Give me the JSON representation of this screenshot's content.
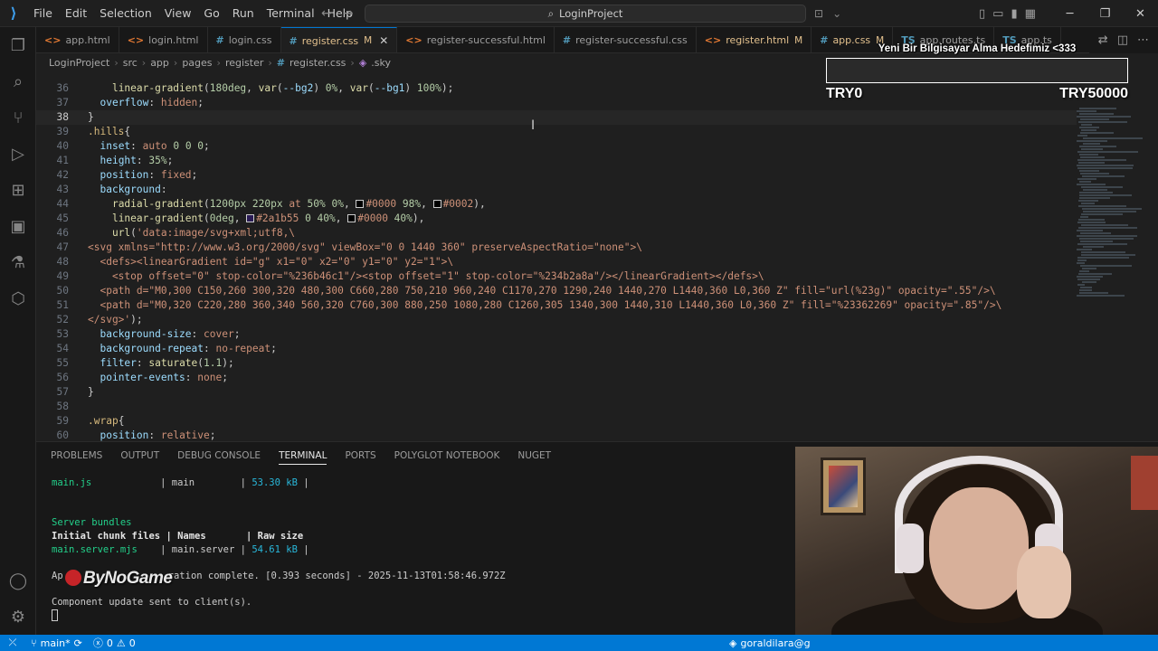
{
  "titlebar": {
    "menu": [
      "File",
      "Edit",
      "Selection",
      "View",
      "Go",
      "Run",
      "Terminal",
      "Help"
    ],
    "search_label": "LoginProject"
  },
  "tabs": [
    {
      "icon": "<>",
      "icon_color": "#e37933",
      "label": "app.html",
      "modified": "",
      "active": false
    },
    {
      "icon": "<>",
      "icon_color": "#e37933",
      "label": "login.html",
      "modified": "",
      "active": false
    },
    {
      "icon": "#",
      "icon_color": "#519aba",
      "label": "login.css",
      "modified": "",
      "active": false
    },
    {
      "icon": "#",
      "icon_color": "#519aba",
      "label": "register.css",
      "modified": "M",
      "active": true
    },
    {
      "icon": "<>",
      "icon_color": "#e37933",
      "label": "register-successful.html",
      "modified": "",
      "active": false
    },
    {
      "icon": "#",
      "icon_color": "#519aba",
      "label": "register-successful.css",
      "modified": "",
      "active": false
    },
    {
      "icon": "<>",
      "icon_color": "#e37933",
      "label": "register.html",
      "modified": "M",
      "active": false
    },
    {
      "icon": "#",
      "icon_color": "#519aba",
      "label": "app.css",
      "modified": "M",
      "active": false
    },
    {
      "icon": "TS",
      "icon_color": "#519aba",
      "label": "app.routes.ts",
      "modified": "",
      "active": false
    },
    {
      "icon": "TS",
      "icon_color": "#519aba",
      "label": "app.ts",
      "modified": "",
      "active": false
    }
  ],
  "breadcrumb": [
    "LoginProject",
    "src",
    "app",
    "pages",
    "register",
    "register.css",
    ".sky"
  ],
  "editor": {
    "lines": [
      {
        "n": "36",
        "tokens": [
          [
            "c-punc",
            "    "
          ],
          [
            "c-fn",
            "linear-gradient"
          ],
          [
            "c-punc",
            "("
          ],
          [
            "c-num",
            "180deg"
          ],
          [
            "c-punc",
            ", "
          ],
          [
            "c-fn",
            "var"
          ],
          [
            "c-punc",
            "("
          ],
          [
            "c-prop",
            "--bg2"
          ],
          [
            "c-punc",
            ") "
          ],
          [
            "c-num",
            "0%"
          ],
          [
            "c-punc",
            ", "
          ],
          [
            "c-fn",
            "var"
          ],
          [
            "c-punc",
            "("
          ],
          [
            "c-prop",
            "--bg1"
          ],
          [
            "c-punc",
            ") "
          ],
          [
            "c-num",
            "100%"
          ],
          [
            "c-punc",
            ");"
          ]
        ]
      },
      {
        "n": "37",
        "tokens": [
          [
            "c-punc",
            "  "
          ],
          [
            "c-prop",
            "overflow"
          ],
          [
            "c-punc",
            ": "
          ],
          [
            "c-val",
            "hidden"
          ],
          [
            "c-punc",
            ";"
          ]
        ]
      },
      {
        "n": "38",
        "cur": true,
        "tokens": [
          [
            "c-punc",
            "}"
          ]
        ]
      },
      {
        "n": "39",
        "tokens": [
          [
            "c-sel",
            ".hills"
          ],
          [
            "c-punc",
            "{"
          ]
        ]
      },
      {
        "n": "40",
        "tokens": [
          [
            "c-punc",
            "  "
          ],
          [
            "c-prop",
            "inset"
          ],
          [
            "c-punc",
            ": "
          ],
          [
            "c-val",
            "auto "
          ],
          [
            "c-num",
            "0 0 0"
          ],
          [
            "c-punc",
            ";"
          ]
        ]
      },
      {
        "n": "41",
        "tokens": [
          [
            "c-punc",
            "  "
          ],
          [
            "c-prop",
            "height"
          ],
          [
            "c-punc",
            ": "
          ],
          [
            "c-num",
            "35%"
          ],
          [
            "c-punc",
            ";"
          ]
        ]
      },
      {
        "n": "42",
        "tokens": [
          [
            "c-punc",
            "  "
          ],
          [
            "c-prop",
            "position"
          ],
          [
            "c-punc",
            ": "
          ],
          [
            "c-val",
            "fixed"
          ],
          [
            "c-punc",
            ";"
          ]
        ]
      },
      {
        "n": "43",
        "tokens": [
          [
            "c-punc",
            "  "
          ],
          [
            "c-prop",
            "background"
          ],
          [
            "c-punc",
            ":"
          ]
        ]
      },
      {
        "n": "44",
        "tokens": [
          [
            "c-punc",
            "    "
          ],
          [
            "c-fn",
            "radial-gradient"
          ],
          [
            "c-punc",
            "("
          ],
          [
            "c-num",
            "1200px 220px"
          ],
          [
            "c-val",
            " at "
          ],
          [
            "c-num",
            "50% 0%"
          ],
          [
            "c-punc",
            ", "
          ],
          [
            "swatch",
            "#000000"
          ],
          [
            "c-val",
            "#0000 "
          ],
          [
            "c-num",
            "98%"
          ],
          [
            "c-punc",
            ", "
          ],
          [
            "swatch",
            "#000000"
          ],
          [
            "c-val",
            "#0002"
          ],
          [
            "c-punc",
            "),"
          ]
        ]
      },
      {
        "n": "45",
        "tokens": [
          [
            "c-punc",
            "    "
          ],
          [
            "c-fn",
            "linear-gradient"
          ],
          [
            "c-punc",
            "("
          ],
          [
            "c-num",
            "0deg"
          ],
          [
            "c-punc",
            ", "
          ],
          [
            "swatch",
            "#2a1b55"
          ],
          [
            "c-val",
            "#2a1b55 "
          ],
          [
            "c-num",
            "0 40%"
          ],
          [
            "c-punc",
            ", "
          ],
          [
            "swatch",
            "#000000"
          ],
          [
            "c-val",
            "#0000 "
          ],
          [
            "c-num",
            "40%"
          ],
          [
            "c-punc",
            "),"
          ]
        ]
      },
      {
        "n": "46",
        "tokens": [
          [
            "c-punc",
            "    "
          ],
          [
            "c-fn",
            "url"
          ],
          [
            "c-punc",
            "("
          ],
          [
            "c-val",
            "'data:image/svg+xml;utf8,\\"
          ]
        ]
      },
      {
        "n": "47",
        "tokens": [
          [
            "c-val",
            "<svg xmlns=\"http://www.w3.org/2000/svg\" viewBox=\"0 0 1440 360\" preserveAspectRatio=\"none\">\\"
          ]
        ]
      },
      {
        "n": "48",
        "tokens": [
          [
            "c-val",
            "  <defs><linearGradient id=\"g\" x1=\"0\" x2=\"0\" y1=\"0\" y2=\"1\">\\"
          ]
        ]
      },
      {
        "n": "49",
        "tokens": [
          [
            "c-val",
            "    <stop offset=\"0\" stop-color=\"%236b46c1\"/><stop offset=\"1\" stop-color=\"%234b2a8a\"/></linearGradient></defs>\\"
          ]
        ]
      },
      {
        "n": "50",
        "tokens": [
          [
            "c-val",
            "  <path d=\"M0,300 C150,260 300,320 480,300 C660,280 750,210 960,240 C1170,270 1290,240 1440,270 L1440,360 L0,360 Z\" fill=\"url(%23g)\" opacity=\".55\"/>\\"
          ]
        ]
      },
      {
        "n": "51",
        "tokens": [
          [
            "c-val",
            "  <path d=\"M0,320 C220,280 360,340 560,320 C760,300 880,250 1080,280 C1260,305 1340,300 1440,310 L1440,360 L0,360 Z\" fill=\"%23362269\" opacity=\".85\"/>\\"
          ]
        ]
      },
      {
        "n": "52",
        "tokens": [
          [
            "c-val",
            "</svg>'"
          ],
          [
            "c-punc",
            ");"
          ]
        ]
      },
      {
        "n": "53",
        "tokens": [
          [
            "c-punc",
            "  "
          ],
          [
            "c-prop",
            "background-size"
          ],
          [
            "c-punc",
            ": "
          ],
          [
            "c-val",
            "cover"
          ],
          [
            "c-punc",
            ";"
          ]
        ]
      },
      {
        "n": "54",
        "tokens": [
          [
            "c-punc",
            "  "
          ],
          [
            "c-prop",
            "background-repeat"
          ],
          [
            "c-punc",
            ": "
          ],
          [
            "c-val",
            "no-repeat"
          ],
          [
            "c-punc",
            ";"
          ]
        ]
      },
      {
        "n": "55",
        "tokens": [
          [
            "c-punc",
            "  "
          ],
          [
            "c-prop",
            "filter"
          ],
          [
            "c-punc",
            ": "
          ],
          [
            "c-fn",
            "saturate"
          ],
          [
            "c-punc",
            "("
          ],
          [
            "c-num",
            "1.1"
          ],
          [
            "c-punc",
            ");"
          ]
        ]
      },
      {
        "n": "56",
        "tokens": [
          [
            "c-punc",
            "  "
          ],
          [
            "c-prop",
            "pointer-events"
          ],
          [
            "c-punc",
            ": "
          ],
          [
            "c-val",
            "none"
          ],
          [
            "c-punc",
            ";"
          ]
        ]
      },
      {
        "n": "57",
        "tokens": [
          [
            "c-punc",
            "}"
          ]
        ]
      },
      {
        "n": "58",
        "tokens": []
      },
      {
        "n": "59",
        "tokens": [
          [
            "c-sel",
            ".wrap"
          ],
          [
            "c-punc",
            "{"
          ]
        ]
      },
      {
        "n": "60",
        "tokens": [
          [
            "c-punc",
            "  "
          ],
          [
            "c-prop",
            "position"
          ],
          [
            "c-punc",
            ": "
          ],
          [
            "c-val",
            "relative"
          ],
          [
            "c-punc",
            ";"
          ]
        ]
      }
    ]
  },
  "donation": {
    "title": "Yeni Bir Bilgisayar Alma Hedefimiz <333",
    "min_label": "TRY0",
    "max_label": "TRY50000",
    "progress": 0.0
  },
  "panel": {
    "tabs": [
      "PROBLEMS",
      "OUTPUT",
      "DEBUG CONSOLE",
      "TERMINAL",
      "PORTS",
      "POLYGLOT NOTEBOOK",
      "NUGET"
    ],
    "active_tab": "TERMINAL",
    "terminal": {
      "row1": {
        "file": "main.js",
        "sep1": "| ",
        "name": "main",
        "sep2": "| ",
        "size": "53.30 kB",
        "sep3": " |"
      },
      "server_bundles": "Server bundles",
      "header": {
        "c1": "Initial chunk files",
        "sep1": "| ",
        "c2": "Names",
        "sep2": "| ",
        "c3": "Raw size"
      },
      "row2": {
        "file": "main.server.mjs",
        "sep1": "| ",
        "name": "main.server",
        "sep2": "| ",
        "size": "54.61 kB",
        "sep3": " |"
      },
      "gen_prefix": "Ap",
      "gen_suffix": "ration complete. [0.393 seconds] - 2025-11-13T01:58:46.972Z",
      "update": "Component update sent to client(s)."
    },
    "watermark": "ByNoGame"
  },
  "statusbar": {
    "branch": "main*",
    "problems": "0",
    "warnings": "0",
    "account": "goraldilara@g"
  }
}
